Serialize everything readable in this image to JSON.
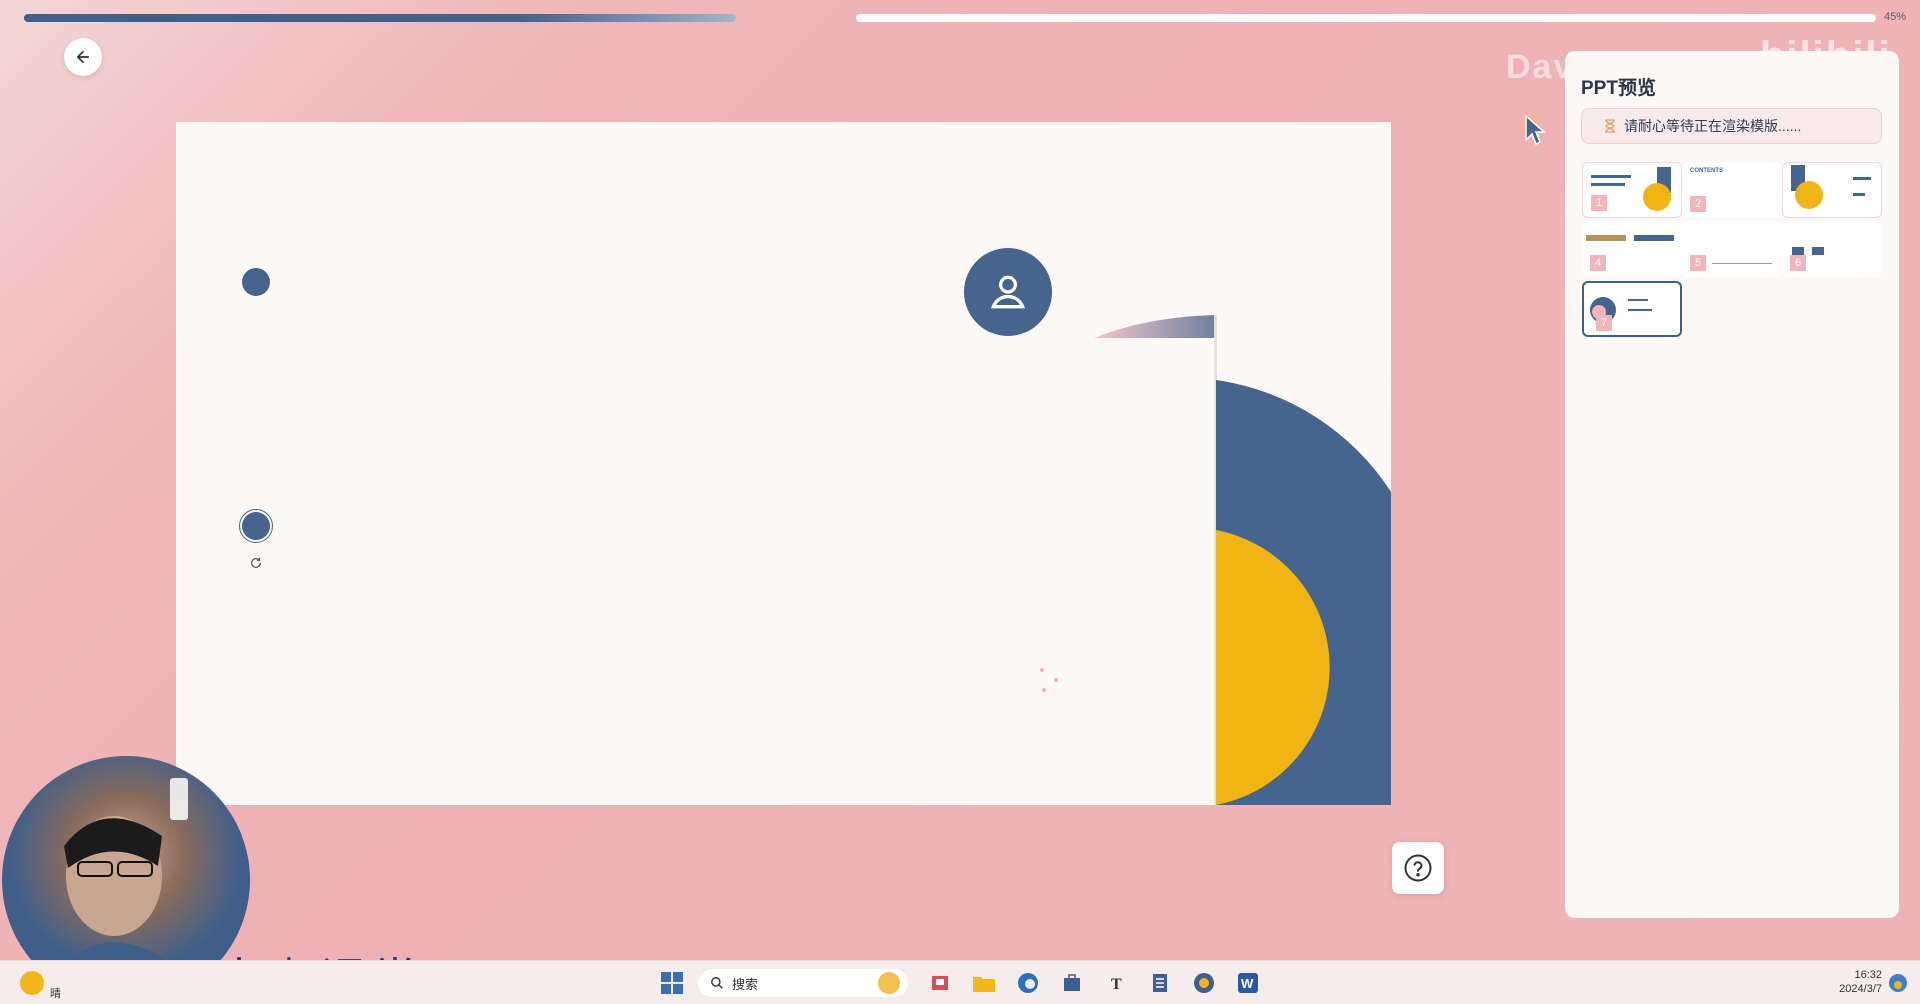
{
  "progress": {
    "value_percent": 45,
    "label": "45%"
  },
  "watermark": {
    "name": "Dav",
    "logo": "bilibili"
  },
  "preview_panel": {
    "title": "PPT预览",
    "notice": "请耐心等待正在渲染模版......",
    "thumbnails": [
      {
        "number": "1",
        "heading": "",
        "active": false
      },
      {
        "number": "2",
        "heading": "CONTENTS",
        "active": false
      },
      {
        "number": "3",
        "heading": "",
        "active": false
      },
      {
        "number": "4",
        "heading": "",
        "active": false
      },
      {
        "number": "5",
        "heading": "",
        "active": false
      },
      {
        "number": "6",
        "heading": "",
        "active": false
      },
      {
        "number": "7",
        "heading": "",
        "active": true
      }
    ]
  },
  "brand": {
    "text": "大咖课堂"
  },
  "taskbar": {
    "search_label": "搜索",
    "weather_text": "晴",
    "time": "16:32",
    "date": "2024/3/7"
  },
  "colors": {
    "background": "#eeb1b4",
    "accent_blue": "#45648e",
    "accent_yellow": "#f0b414",
    "slide_bg": "#fcf8f6"
  },
  "icons": {
    "back": "arrow-left-icon",
    "help": "question-circle-icon",
    "user": "user-icon",
    "hourglass": "hourglass-icon",
    "search": "search-icon",
    "windows": "windows-start-icon"
  }
}
